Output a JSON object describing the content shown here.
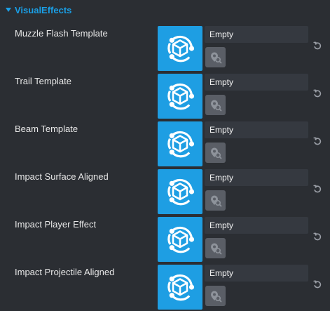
{
  "section": {
    "title": "VisualEffects",
    "expanded": true
  },
  "properties": [
    {
      "label": "Muzzle Flash Template",
      "value": "Empty"
    },
    {
      "label": "Trail Template",
      "value": "Empty"
    },
    {
      "label": "Beam Template",
      "value": "Empty"
    },
    {
      "label": "Impact Surface Aligned",
      "value": "Empty"
    },
    {
      "label": "Impact Player Effect",
      "value": "Empty"
    },
    {
      "label": "Impact Projectile Aligned",
      "value": "Empty"
    }
  ],
  "icons": {
    "section_toggle": "chevron-down-icon",
    "asset_thumbnail": "template-asset-icon",
    "asset_picker": "asset-picker-icon",
    "reset": "reset-icon"
  },
  "colors": {
    "background": "#2b2e33",
    "accent": "#1a9fe6",
    "thumbnail_bg": "#1e9ee3",
    "field_bg": "#353940",
    "button_bg": "#5a5e66"
  }
}
